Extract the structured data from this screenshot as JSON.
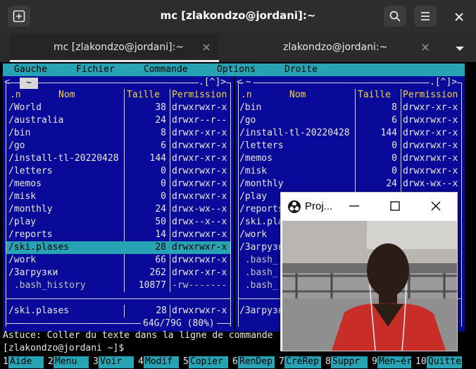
{
  "window": {
    "title": "mc [zlakondzo@jordani]:~",
    "icons": {
      "new_tab": "new-tab-icon",
      "search": "search-icon",
      "menu": "hamburger-menu-icon",
      "close": "close-icon"
    }
  },
  "tabs": [
    {
      "label": "mc [zlakondzo@jordani]:~",
      "active": true
    },
    {
      "label": "zlakondzo@jordani:~",
      "active": false
    }
  ],
  "mc": {
    "menu": [
      "Gauche",
      "Fichier",
      "Commande",
      "Options",
      "Droite"
    ],
    "left_panel": {
      "path": "~",
      "nav": ".[^]>",
      "headers": {
        "sort": ".n",
        "name": "Nom",
        "size": "Taille",
        "perm": "Permission"
      },
      "rows": [
        {
          "name": "/World",
          "size": "38",
          "perm": "drwxrwxr-x"
        },
        {
          "name": "/australia",
          "size": "24",
          "perm": "drwxr--r--"
        },
        {
          "name": "/bin",
          "size": "8",
          "perm": "drwxr-xr-x"
        },
        {
          "name": "/go",
          "size": "6",
          "perm": "drwxrwxr-x"
        },
        {
          "name": "/install-tl-20220428",
          "size": "144",
          "perm": "drwxr-xr-x"
        },
        {
          "name": "/letters",
          "size": "0",
          "perm": "drwxrwxr-x"
        },
        {
          "name": "/memos",
          "size": "0",
          "perm": "drwxrwxr-x"
        },
        {
          "name": "/misk",
          "size": "0",
          "perm": "drwxrwxr-x"
        },
        {
          "name": "/monthly",
          "size": "24",
          "perm": "drwx-wx--x"
        },
        {
          "name": "/play",
          "size": "50",
          "perm": "drwx--x--x"
        },
        {
          "name": "/reports",
          "size": "14",
          "perm": "drwxrwxr-x"
        },
        {
          "name": "/ski.plases",
          "size": "28",
          "perm": "drwxrwxr-x",
          "selected": true
        },
        {
          "name": "/work",
          "size": "66",
          "perm": "drwxrwxr-x"
        },
        {
          "name": "/Загрузки",
          "size": "262",
          "perm": "drwxr-xr-x"
        },
        {
          "name": " .bash_history",
          "size": "10877",
          "perm": "-rw-------"
        }
      ],
      "status": {
        "name": "/ski.plases",
        "size": "28",
        "perm": "drwxrwxr-x"
      },
      "disk": "64G/79G (80%)"
    },
    "right_panel": {
      "path": "~",
      "nav": ".[^]>",
      "headers": {
        "sort": ".n",
        "name": "Nom",
        "size": "Taille",
        "perm": "Permission"
      },
      "rows": [
        {
          "name": "/bin",
          "size": "8",
          "perm": "drwxr-xr-x"
        },
        {
          "name": "/go",
          "size": "6",
          "perm": "drwxrwxr-x"
        },
        {
          "name": "/install-tl-20220428",
          "size": "144",
          "perm": "drwxr-xr-x"
        },
        {
          "name": "/letters",
          "size": "0",
          "perm": "drwxrwxr-x"
        },
        {
          "name": "/memos",
          "size": "0",
          "perm": "drwxrwxr-x"
        },
        {
          "name": "/misk",
          "size": "0",
          "perm": "drwxrwxr-x"
        },
        {
          "name": "/monthly",
          "size": "24",
          "perm": "drwx-wx--x"
        },
        {
          "name": "/play",
          "size": "",
          "perm": ""
        },
        {
          "name": "/reports",
          "size": "",
          "perm": ""
        },
        {
          "name": "/ski.pla",
          "size": "",
          "perm": ""
        },
        {
          "name": "/work",
          "size": "",
          "perm": ""
        },
        {
          "name": "/Загрузк",
          "size": "",
          "perm": ""
        },
        {
          "name": " .bash_",
          "size": "",
          "perm": ""
        },
        {
          "name": " .bash_",
          "size": "",
          "perm": ""
        },
        {
          "name": " .bash_",
          "size": "",
          "perm": ""
        }
      ],
      "status": {
        "name": "/Загрузк",
        "size": "",
        "perm": ""
      }
    },
    "hint": "Astuce: Coller du texte dans la ligne de commande",
    "prompt": "[zlakondzo@jordani ~]$",
    "fkeys": [
      {
        "num": "1",
        "label": "Aide"
      },
      {
        "num": "2",
        "label": "Menu"
      },
      {
        "num": "3",
        "label": "Voir"
      },
      {
        "num": "4",
        "label": "Modif"
      },
      {
        "num": "5",
        "label": "Copier"
      },
      {
        "num": "6",
        "label": "RenDep"
      },
      {
        "num": "7",
        "label": "CréRep"
      },
      {
        "num": "8",
        "label": "Suppr"
      },
      {
        "num": "9",
        "label": "Men~ér"
      },
      {
        "num": "10",
        "label": "Quitter"
      }
    ]
  },
  "projector": {
    "title": "Proj...",
    "icons": {
      "app": "obs-logo-icon",
      "minimize": "minimize-icon",
      "maximize": "maximize-icon",
      "close": "close-icon"
    }
  }
}
